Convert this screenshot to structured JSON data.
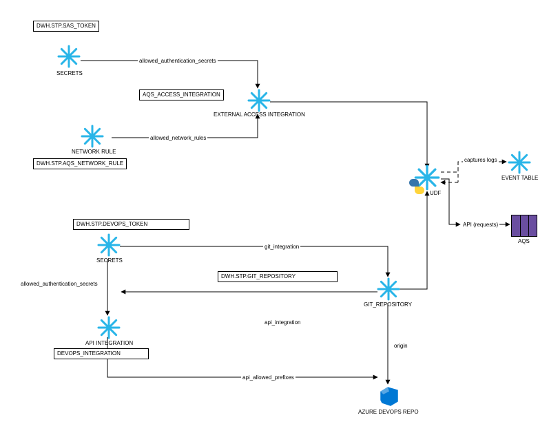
{
  "nodes": {
    "sas_token_box": "DWH.STP.SAS_TOKEN",
    "secrets1_caption": "SECRETS",
    "aqs_access_integration_box": "AQS_ACCESS_INTEGRATION",
    "external_access_caption": "EXTERNAL ACCESS INTEGRATION",
    "network_rule_caption": "NETWORK RULE",
    "aqs_network_rule_box": "DWH.STP.AQS_NETWORK_RULE",
    "udf_caption": "UDF",
    "event_table_caption": "EVENT TABLE",
    "aqs_caption": "AQS",
    "devops_token_box": "DWH.STP.DEVOPS_TOKEN",
    "secrets2_caption": "SECRETS",
    "git_repo_box": "DWH.STP.GIT_REPOSITORY",
    "git_repo_caption": "GIT_REPOSITORY",
    "api_integration_caption": "API INTEGRATION",
    "devops_integration_box": "DEVOPS_INTEGRATION",
    "azure_devops_repo_caption": "AZURE DEVOPS REPO"
  },
  "edges": {
    "allowed_auth_secrets1": "allowed_authentication_secrets",
    "allowed_network_rules": "allowed_network_rules",
    "captures_logs": "captures logs",
    "api_requests": "API (requests)",
    "git_integration": "git_integration",
    "allowed_auth_secrets2": "allowed_authentication_secrets",
    "api_integration": "api_integration",
    "origin": "origin",
    "api_allowed_prefixes": "api_allowed_prefixes"
  },
  "chart_data": {
    "type": "diagram",
    "title": "",
    "nodes": [
      {
        "id": "sas_token",
        "kind": "box",
        "label": "DWH.STP.SAS_TOKEN"
      },
      {
        "id": "secrets1",
        "kind": "snowflake",
        "label": "SECRETS"
      },
      {
        "id": "ext_access",
        "kind": "snowflake",
        "label": "EXTERNAL ACCESS INTEGRATION",
        "box_label": "AQS_ACCESS_INTEGRATION"
      },
      {
        "id": "network_rule",
        "kind": "snowflake",
        "label": "NETWORK RULE",
        "box_label": "DWH.STP.AQS_NETWORK_RULE"
      },
      {
        "id": "udf",
        "kind": "snowflake",
        "label": "UDF",
        "decorated": "python"
      },
      {
        "id": "event_table",
        "kind": "snowflake",
        "label": "EVENT TABLE"
      },
      {
        "id": "aqs",
        "kind": "service",
        "label": "AQS"
      },
      {
        "id": "devops_token",
        "kind": "box",
        "label": "DWH.STP.DEVOPS_TOKEN"
      },
      {
        "id": "secrets2",
        "kind": "snowflake",
        "label": "SECRETS"
      },
      {
        "id": "git_repo",
        "kind": "snowflake",
        "label": "GIT_REPOSITORY",
        "box_label": "DWH.STP.GIT_REPOSITORY"
      },
      {
        "id": "api_integration",
        "kind": "snowflake",
        "label": "API INTEGRATION",
        "box_label": "DEVOPS_INTEGRATION"
      },
      {
        "id": "azure_repo",
        "kind": "azure",
        "label": "AZURE DEVOPS REPO"
      }
    ],
    "edges": [
      {
        "from": "secrets1",
        "to": "ext_access",
        "label": "allowed_authentication_secrets"
      },
      {
        "from": "network_rule",
        "to": "ext_access",
        "label": "allowed_network_rules"
      },
      {
        "from": "ext_access",
        "to": "udf",
        "label": ""
      },
      {
        "from": "udf",
        "to": "event_table",
        "label": "captures logs",
        "style": "dashed"
      },
      {
        "from": "udf",
        "to": "aqs",
        "label": "API (requests)"
      },
      {
        "from": "secrets2",
        "to": "git_repo",
        "label": "git_integration"
      },
      {
        "from": "secrets2",
        "to": "api_integration",
        "label": "allowed_authentication_secrets"
      },
      {
        "from": "api_integration",
        "to": "git_repo",
        "label": "api_integration"
      },
      {
        "from": "git_repo",
        "to": "udf",
        "label": ""
      },
      {
        "from": "git_repo",
        "to": "azure_repo",
        "label": "origin"
      },
      {
        "from": "api_integration",
        "to": "azure_repo",
        "label": "api_allowed_prefixes"
      }
    ]
  }
}
